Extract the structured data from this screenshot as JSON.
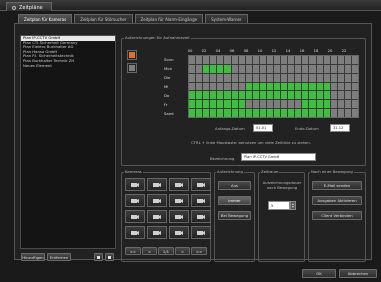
{
  "window": {
    "title": "Zeitpläne"
  },
  "tabs": [
    {
      "label": "Zeitplan für Kameras",
      "active": true
    },
    {
      "label": "Zeitplan für Störsucher",
      "active": false
    },
    {
      "label": "Zeitplan für Alarm-Eingänge",
      "active": false
    },
    {
      "label": "System-Warner",
      "active": false
    }
  ],
  "schedule_list": {
    "items": [
      "Plan IP-CCTV GmbH",
      "Plan CTI-Sicherheit Germany",
      "Plan Elektro Burkhalter AG",
      "Plan Hansa GmbH",
      "Plan P.I. Sicherheitstechnik",
      "Plan Burkhalter Technik ZH",
      "Neues Element"
    ],
    "selected_index": 0,
    "add_label": "Hinzufügen",
    "remove_label": "Entfernen"
  },
  "schedule": {
    "group_label": "Aufzeichnungen für Aufnahmezeit",
    "hours": [
      "00",
      "02",
      "04",
      "06",
      "08",
      "10",
      "12",
      "14",
      "16",
      "18",
      "20",
      "22"
    ],
    "days": [
      "Sonn",
      "Mon",
      "Die",
      "Mi",
      "Do",
      "Fr",
      "Samt"
    ],
    "active": [
      [
        0,
        0,
        0,
        0,
        0,
        0,
        0,
        0,
        0,
        0,
        0,
        0,
        0,
        0,
        0,
        0,
        0,
        0,
        0,
        0,
        0,
        0,
        0,
        0
      ],
      [
        0,
        0,
        1,
        1,
        1,
        1,
        0,
        0,
        0,
        0,
        0,
        0,
        0,
        0,
        0,
        0,
        0,
        0,
        0,
        0,
        0,
        0,
        0,
        0
      ],
      [
        0,
        0,
        0,
        0,
        0,
        0,
        0,
        0,
        0,
        0,
        0,
        0,
        0,
        0,
        0,
        0,
        0,
        0,
        0,
        0,
        0,
        0,
        0,
        0
      ],
      [
        0,
        0,
        0,
        0,
        0,
        0,
        0,
        0,
        1,
        1,
        1,
        1,
        1,
        1,
        1,
        1,
        1,
        1,
        1,
        1,
        0,
        0,
        0,
        0
      ],
      [
        1,
        1,
        1,
        1,
        1,
        1,
        1,
        1,
        1,
        1,
        1,
        1,
        1,
        1,
        1,
        1,
        1,
        1,
        1,
        1,
        0,
        0,
        0,
        0
      ],
      [
        1,
        1,
        1,
        1,
        1,
        1,
        1,
        1,
        0,
        0,
        0,
        0,
        0,
        0,
        0,
        0,
        1,
        1,
        1,
        1,
        0,
        0,
        0,
        0
      ],
      [
        1,
        1,
        1,
        1,
        1,
        1,
        1,
        1,
        1,
        1,
        1,
        1,
        1,
        1,
        1,
        1,
        1,
        1,
        1,
        1,
        0,
        0,
        0,
        0
      ]
    ],
    "legend_on_color": "#3fbf3f",
    "legend_off_color": "#7e7e7e",
    "start_label": "Anfangs-Datum",
    "start_value": "01.01",
    "end_label": "Ende-Datum",
    "end_value": "31.12",
    "hint": "CTRL + linke Maustaste: benutzen um viele Zeitlinie zu ziehen.",
    "description_label": "Bezeichnung",
    "description_value": "Plan IP-CCTV GmbH"
  },
  "cameras": {
    "label": "Kameras",
    "count": 16,
    "nav": [
      "<<",
      "<",
      "1/1",
      ">",
      ">>"
    ]
  },
  "recording": {
    "label": "Aufzeichnung",
    "buttons": [
      "Aus",
      "Immer",
      "Bei Bewegung"
    ]
  },
  "delay": {
    "label": "Zeitraum",
    "text": "Aufzeichnungsdauer nach Bewegung",
    "value": "5"
  },
  "after_motion": {
    "label": "Nach einer Bewegung",
    "buttons": [
      "E-Mail senden",
      "Ausgaben Aktivieren",
      "Client Verbinden"
    ]
  },
  "footer": {
    "ok": "OK",
    "cancel": "Abbrechen"
  }
}
